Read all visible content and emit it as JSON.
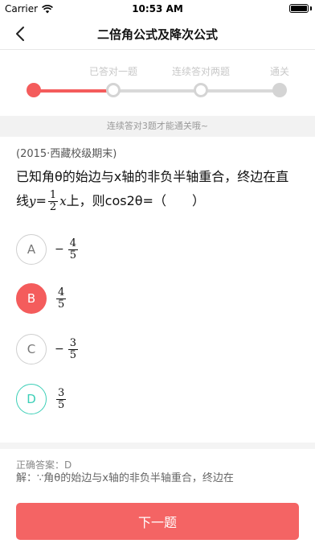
{
  "status": {
    "carrier": "Carrier",
    "time": "10:53 AM"
  },
  "nav": {
    "title": "二倍角公式及降次公式"
  },
  "progress": {
    "steps": [
      "已答对一题",
      "连续答对两题",
      "通关"
    ],
    "hint": "连续答对3题才能通关哦~"
  },
  "question": {
    "source": "(2015·西藏校级期末)",
    "line1": "已知角θ的始边与x轴的非负半轴重合，终边在直",
    "line2_prefix": "线",
    "line2_y": "y",
    "line2_eq": "=",
    "line2_frac_num": "1",
    "line2_frac_den": "2",
    "line2_x": "x",
    "line2_suffix": "上，则cos2θ=（　　）"
  },
  "options": [
    {
      "letter": "A",
      "sign": "−",
      "num": "4",
      "den": "5",
      "state": "normal"
    },
    {
      "letter": "B",
      "sign": "",
      "num": "4",
      "den": "5",
      "state": "wrong"
    },
    {
      "letter": "C",
      "sign": "−",
      "num": "3",
      "den": "5",
      "state": "normal"
    },
    {
      "letter": "D",
      "sign": "",
      "num": "3",
      "den": "5",
      "state": "correct"
    }
  ],
  "answer": {
    "label": "正确答案：D",
    "analysis": "解：∵角θ的始边与x轴的非负半轴重合，终边在"
  },
  "next_button": "下一题",
  "colors": {
    "accent": "#f45c5c",
    "correct": "#3ccfb7",
    "button": "#f46464"
  }
}
